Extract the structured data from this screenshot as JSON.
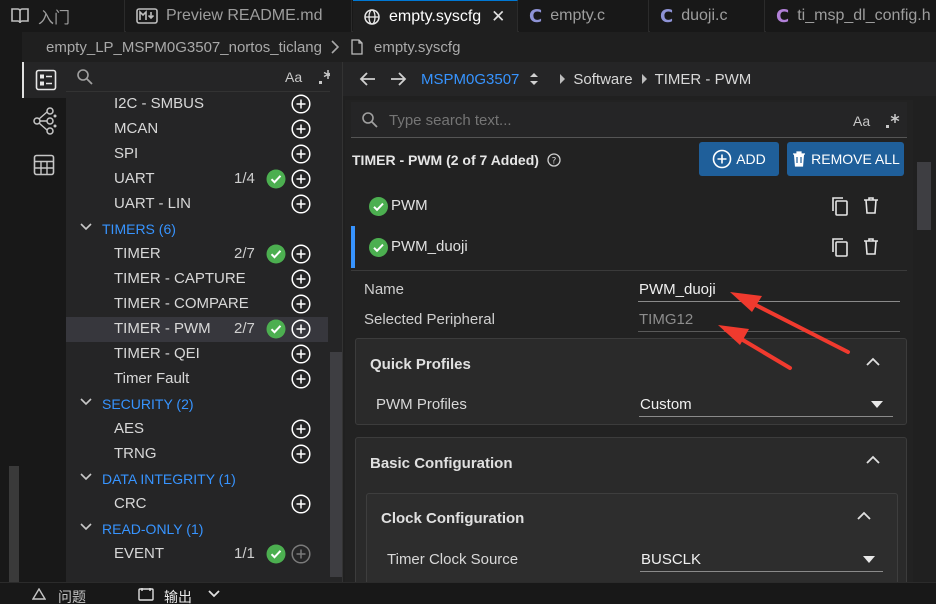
{
  "tabs": [
    {
      "label": "入门",
      "icon": "book-icon"
    },
    {
      "label": "Preview README.md",
      "icon": "markdown-preview-icon"
    },
    {
      "label": "empty.syscfg",
      "icon": "globe-icon",
      "active": true
    },
    {
      "label": "empty.c",
      "icon": "c-file-icon"
    },
    {
      "label": "duoji.c",
      "icon": "c-file-icon"
    },
    {
      "label": "ti_msp_dl_config.h",
      "icon": "c-file-icon"
    }
  ],
  "breadcrumb": {
    "project": "empty_LP_MSPM0G3507_nortos_ticlang",
    "file": "empty.syscfg"
  },
  "sidebar": {
    "search_case_label": "Aa",
    "items": [
      {
        "label": "I2C - SMBUS",
        "count": "",
        "added": false
      },
      {
        "label": "MCAN",
        "count": "",
        "added": false
      },
      {
        "label": "SPI",
        "count": "",
        "added": false
      },
      {
        "label": "UART",
        "count": "1/4",
        "added": true
      },
      {
        "label": "UART - LIN",
        "count": "",
        "added": false
      },
      {
        "label": "TIMERS (6)",
        "category": true
      },
      {
        "label": "TIMER",
        "count": "2/7",
        "added": true
      },
      {
        "label": "TIMER - CAPTURE",
        "count": "",
        "added": false
      },
      {
        "label": "TIMER - COMPARE",
        "count": "",
        "added": false
      },
      {
        "label": "TIMER - PWM",
        "count": "2/7",
        "added": true,
        "selected": true
      },
      {
        "label": "TIMER - QEI",
        "count": "",
        "added": false
      },
      {
        "label": "Timer Fault",
        "count": "",
        "added": false
      },
      {
        "label": "SECURITY (2)",
        "category": true
      },
      {
        "label": "AES",
        "count": "",
        "added": false
      },
      {
        "label": "TRNG",
        "count": "",
        "added": false
      },
      {
        "label": "DATA INTEGRITY (1)",
        "category": true
      },
      {
        "label": "CRC",
        "count": "",
        "added": false
      },
      {
        "label": "READ-ONLY (1)",
        "category": true
      },
      {
        "label": "EVENT",
        "count": "1/1",
        "added": true,
        "disabled_plus": true
      }
    ]
  },
  "nav": {
    "device": "MSPM0G3507",
    "path": [
      "Software",
      "TIMER - PWM"
    ]
  },
  "search": {
    "placeholder": "Type search text...",
    "case_label": "Aa"
  },
  "module": {
    "title": "TIMER - PWM (2 of 7 Added)",
    "add_label": "ADD",
    "remove_all_label": "REMOVE ALL",
    "instances": [
      {
        "name": "PWM",
        "selected": false
      },
      {
        "name": "PWM_duoji",
        "selected": true
      }
    ]
  },
  "props": {
    "name_label": "Name",
    "name_value": "PWM_duoji",
    "periph_label": "Selected Peripheral",
    "periph_value": "TIMG12"
  },
  "quick_profiles": {
    "title": "Quick Profiles",
    "profile_label": "PWM Profiles",
    "profile_value": "Custom"
  },
  "basic_config": {
    "title": "Basic Configuration",
    "clock_title": "Clock Configuration",
    "clock_source_label": "Timer Clock Source",
    "clock_source_value": "BUSCLK"
  },
  "bottom": {
    "problems_label": "问题",
    "output_label": "输出"
  },
  "colors": {
    "accent": "#3794ff",
    "check": "#4caf50",
    "button": "#1f5f9a",
    "arrow": "#f03a2e"
  }
}
